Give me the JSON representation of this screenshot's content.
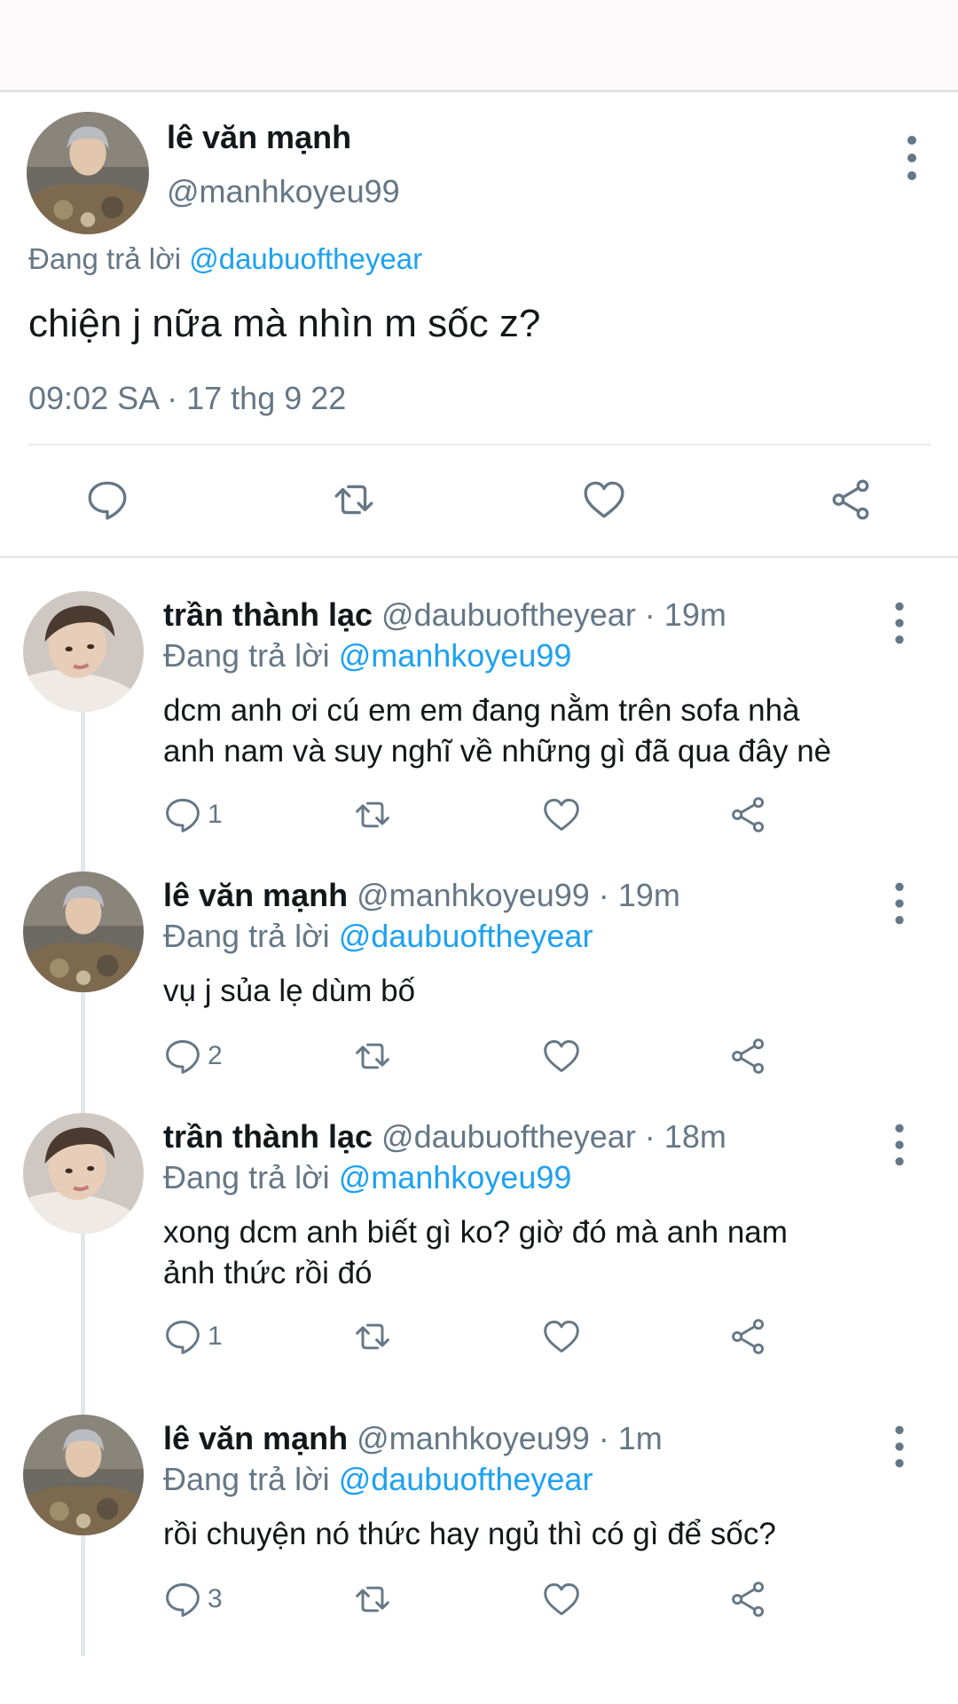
{
  "colors": {
    "accent": "#1da1f2",
    "muted": "#657786",
    "text": "#14171a",
    "divider": "#e6ecf0"
  },
  "main_tweet": {
    "name": "lê văn mạnh",
    "handle": "@manhkoyeu99",
    "replying_prefix": "Đang trả lời ",
    "replying_to": "@daubuoftheyear",
    "text": "chiện j nữa mà nhìn m sốc z?",
    "timestamp": "09:02 SA · 17 thg 9 22",
    "actions": [
      "reply-icon",
      "retweet-icon",
      "like-icon",
      "share-icon"
    ]
  },
  "replies": [
    {
      "name": "trần thành lạc",
      "meta": " @daubuoftheyear · 19m",
      "replying_prefix": "Đang trả lời ",
      "replying_to": "@manhkoyeu99",
      "text_lines": [
        "dcm anh ơi cú em em đang nằm trên sofa nhà",
        "anh nam và suy nghĩ về những gì đã qua đây nè"
      ],
      "reply_count": "1"
    },
    {
      "name": "lê văn mạnh",
      "meta": " @manhkoyeu99 · 19m",
      "replying_prefix": "Đang trả lời ",
      "replying_to": "@daubuoftheyear",
      "text_lines": [
        "vụ j sủa lẹ dùm bố"
      ],
      "reply_count": "2"
    },
    {
      "name": "trần thành lạc",
      "meta": " @daubuoftheyear · 18m",
      "replying_prefix": "Đang trả lời ",
      "replying_to": "@manhkoyeu99",
      "text_lines": [
        "xong dcm anh biết gì ko? giờ đó mà anh nam",
        "ảnh thức rồi đó"
      ],
      "reply_count": "1"
    },
    {
      "name": "lê văn mạnh",
      "meta": " @manhkoyeu99 · 1m",
      "replying_prefix": "Đang trả lời ",
      "replying_to": "@daubuoftheyear",
      "text_lines": [
        "rồi chuyện nó thức hay ngủ thì có gì để sốc?"
      ],
      "reply_count": "3"
    }
  ]
}
